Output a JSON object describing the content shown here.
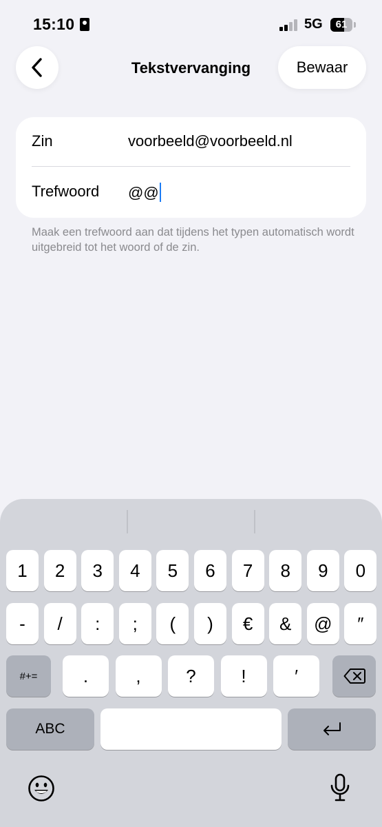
{
  "status_bar": {
    "time": "15:10",
    "network": "5G",
    "battery_level": "61",
    "battery_fraction": 0.61
  },
  "nav": {
    "title": "Tekstvervanging",
    "save_label": "Bewaar"
  },
  "form": {
    "phrase_label": "Zin",
    "phrase_value": "voorbeeld@voorbeeld.nl",
    "shortcut_label": "Trefwoord",
    "shortcut_value": "@@"
  },
  "footnote": "Maak een trefwoord aan dat tijdens het typen automatisch wordt uitgebreid tot het woord of de zin.",
  "keyboard": {
    "row1": [
      "1",
      "2",
      "3",
      "4",
      "5",
      "6",
      "7",
      "8",
      "9",
      "0"
    ],
    "row2": [
      "-",
      "/",
      ":",
      ";",
      "(",
      ")",
      "€",
      "&",
      "@",
      "″"
    ],
    "symbols_key": "#+=",
    "row3": [
      ".",
      ",",
      "?",
      "!",
      "′"
    ],
    "abc_key": "ABC",
    "icons": {
      "delete": "delete-icon",
      "return": "return-icon",
      "emoji": "emoji-icon",
      "mic": "microphone-icon",
      "back": "chevron-left-icon"
    }
  }
}
